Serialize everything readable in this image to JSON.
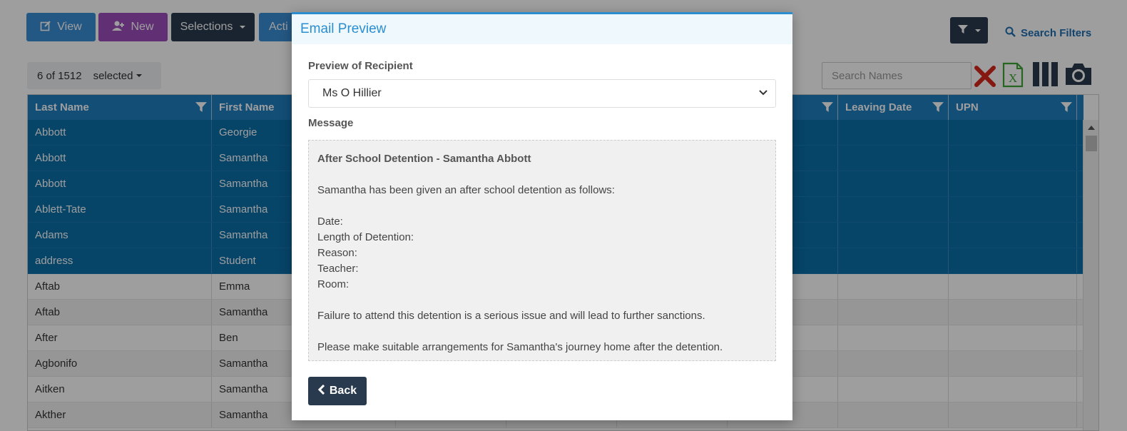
{
  "toolbar": {
    "view_label": "View",
    "new_label": "New",
    "selections_label": "Selections",
    "actions_label": "Acti",
    "search_filters_label": "Search Filters",
    "selection_count": "6 of 1512",
    "selected_label": "selected",
    "search_placeholder": "Search Names"
  },
  "colors": {
    "view": "#3a8fd6",
    "new": "#9b4dbb",
    "dark": "#2a3a4e",
    "header": "#1f7fc0",
    "selected_row": "#0a6fa8",
    "accent": "#2b8ed0"
  },
  "grid": {
    "columns": [
      "Last Name",
      "First Name",
      "",
      "",
      "",
      "",
      "Leaving Date",
      "UPN"
    ],
    "rows": [
      {
        "last": "Abbott",
        "first": "Georgie",
        "selected": true
      },
      {
        "last": "Abbott",
        "first": "Samantha",
        "selected": true
      },
      {
        "last": "Abbott",
        "first": "Samantha",
        "selected": true
      },
      {
        "last": "Ablett-Tate",
        "first": "Samantha",
        "selected": true
      },
      {
        "last": "Adams",
        "first": "Samantha",
        "selected": true
      },
      {
        "last": "address",
        "first": "Student",
        "selected": true
      },
      {
        "last": "Aftab",
        "first": "Emma",
        "selected": false
      },
      {
        "last": "Aftab",
        "first": "Samantha",
        "selected": false
      },
      {
        "last": "After",
        "first": "Ben",
        "selected": false
      },
      {
        "last": "Agbonifo",
        "first": "Samantha",
        "selected": false
      },
      {
        "last": "Aitken",
        "first": "Samantha",
        "selected": false
      },
      {
        "last": "Akther",
        "first": "Samantha",
        "selected": false
      }
    ]
  },
  "modal": {
    "title": "Email Preview",
    "recipient_label": "Preview of Recipient",
    "recipient_value": "Ms O Hillier",
    "message_label": "Message",
    "message": {
      "subject": "After School Detention - Samantha Abbott",
      "intro": "Samantha has been given an after school detention as follows:",
      "fields": [
        "Date:",
        "Length of Detention:",
        "Reason:",
        "Teacher:",
        "Room:"
      ],
      "warning": "Failure to attend this detention is a serious issue and will lead to further sanctions.",
      "arrangements": "Please make suitable arrangements for Samantha's journey home after the detention."
    },
    "back_label": "Back"
  },
  "icons": [
    "edit-icon",
    "user-plus-icon",
    "filter-icon",
    "search-icon",
    "clear-x-icon",
    "excel-icon",
    "columns-icon",
    "camera-icon",
    "chevron-left-icon"
  ]
}
